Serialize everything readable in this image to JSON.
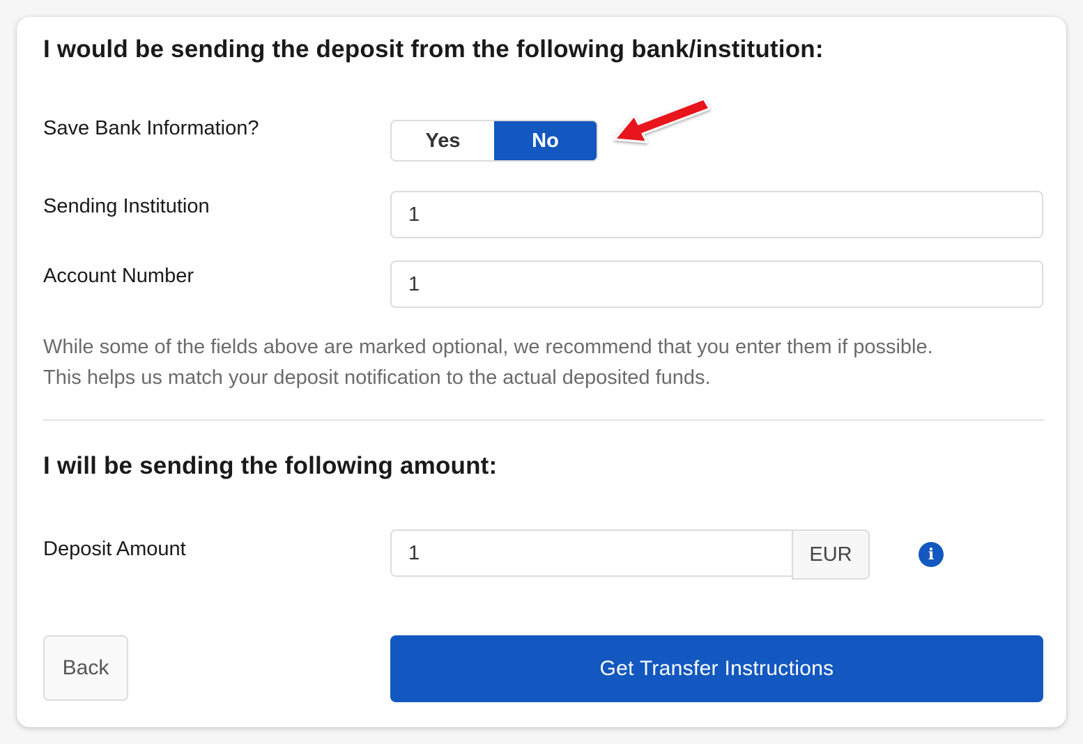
{
  "section_bank": {
    "title": "I would be sending the deposit from the following bank/institution:"
  },
  "save_bank": {
    "label": "Save Bank Information?",
    "yes_label": "Yes",
    "no_label": "No",
    "selected": "No"
  },
  "sending_institution": {
    "label": "Sending Institution",
    "value": "1"
  },
  "account_number": {
    "label": "Account Number",
    "value": "1"
  },
  "help_text": {
    "line1": "While some of the fields above are marked optional, we recommend that you enter them if possible.",
    "line2": "This helps us match your deposit notification to the actual deposited funds."
  },
  "section_amount": {
    "title": "I will be sending the following amount:"
  },
  "deposit_amount": {
    "label": "Deposit Amount",
    "value": "1",
    "currency": "EUR",
    "info_icon": "info-icon"
  },
  "actions": {
    "back_label": "Back",
    "submit_label": "Get Transfer Instructions"
  },
  "colors": {
    "primary": "#1358c0",
    "annotation_arrow": "#e8141a"
  }
}
